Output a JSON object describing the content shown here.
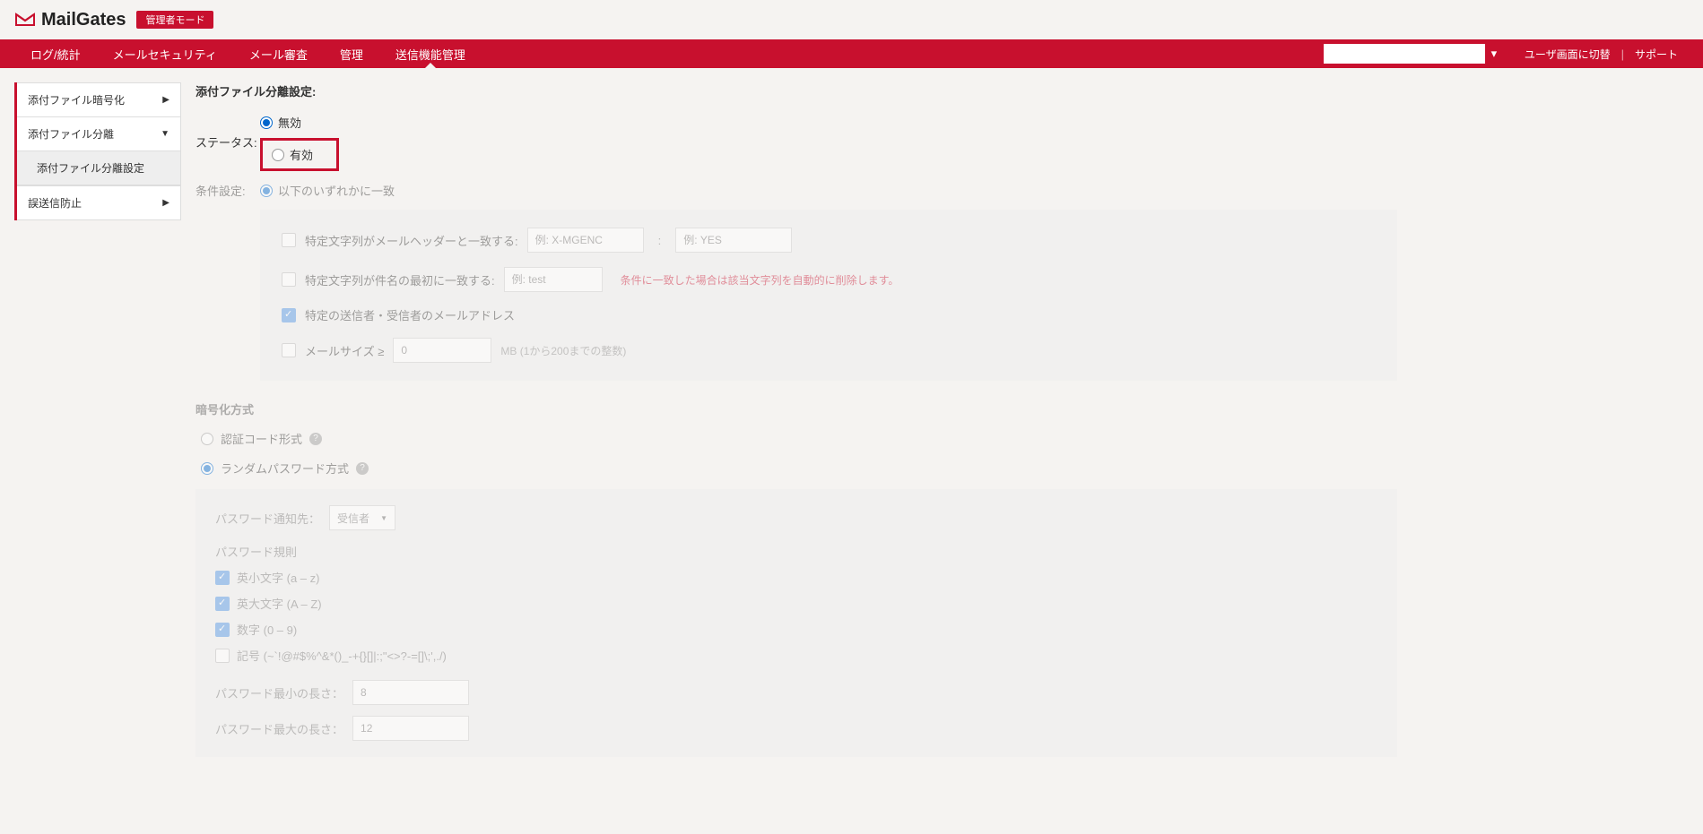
{
  "header": {
    "brand": "MailGates",
    "mode_badge": "管理者モード"
  },
  "nav": {
    "items": [
      "ログ/統計",
      "メールセキュリティ",
      "メール審査",
      "管理",
      "送信機能管理"
    ],
    "user_link": "ユーザ画面に切替",
    "support_link": "サポート"
  },
  "sidebar": {
    "items": [
      {
        "label": "添付ファイル暗号化",
        "arrow": "▶"
      },
      {
        "label": "添付ファイル分離",
        "arrow": "▼"
      },
      {
        "label": "誤送信防止",
        "arrow": "▶"
      }
    ],
    "sub": "添付ファイル分離設定"
  },
  "main": {
    "title": "添付ファイル分離設定:",
    "status_label": "ステータス:",
    "status_disabled": "無効",
    "status_enabled": "有効",
    "cond_label": "条件設定:",
    "cond_opt1": "以下のいずれかに一致",
    "cond": {
      "header_match": "特定文字列がメールヘッダーと一致する:",
      "header_ph1": "例: X-MGENC",
      "header_ph2": "例: YES",
      "subject_match": "特定文字列が件名の最初に一致する:",
      "subject_ph": "例: test",
      "subject_warn": "条件に一致した場合は該当文字列を自動的に削除します。",
      "address_match": "特定の送信者・受信者のメールアドレス",
      "size_label": "メールサイズ ≥",
      "size_ph": "0",
      "size_hint": "MB (1から200までの整数)"
    },
    "enc_title": "暗号化方式",
    "enc_opt1": "認証コード形式",
    "enc_opt2": "ランダムパスワード方式",
    "pwd": {
      "notify_label": "パスワード通知先：",
      "notify_value": "受信者",
      "rules_title": "パスワード規則",
      "rule_lower": "英小文字 (a – z)",
      "rule_upper": "英大文字 (A – Z)",
      "rule_digit": "数字 (0 – 9)",
      "rule_symbol": "記号 (~`!@#$%^&*()_-+{}[]|:;\"<>?-=[]\\;',./)",
      "min_label": "パスワード最小の長さ：",
      "min_val": "8",
      "max_label": "パスワード最大の長さ：",
      "max_val": "12"
    }
  }
}
